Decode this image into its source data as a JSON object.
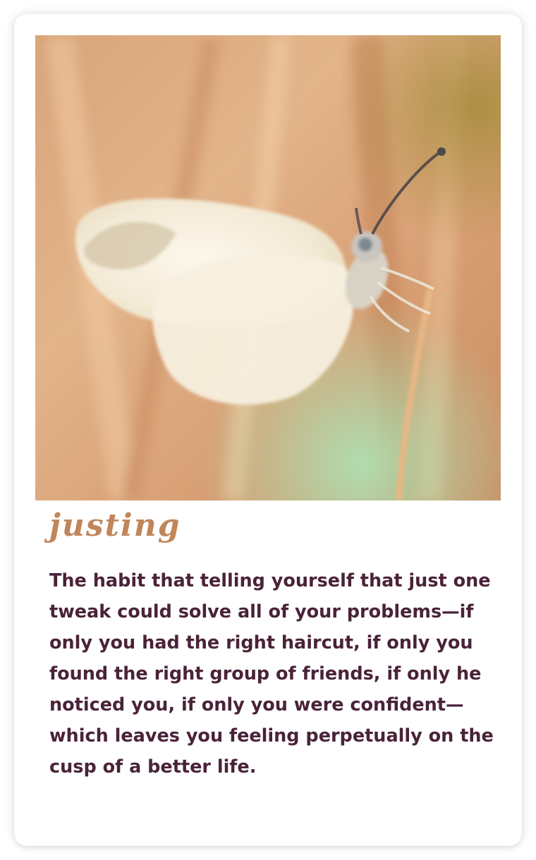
{
  "card": {
    "word": "justing",
    "definition": "The habit that telling yourself that just one tweak could solve all of your problems—if only you had the right haircut, if only you found the right group of friends, if only he noticed you, if only you were confident—which leaves you feeling perpetually on the cusp of a better life."
  },
  "colors": {
    "word": "#c0865a",
    "definition": "#4a2338",
    "background": "#ffffff"
  }
}
